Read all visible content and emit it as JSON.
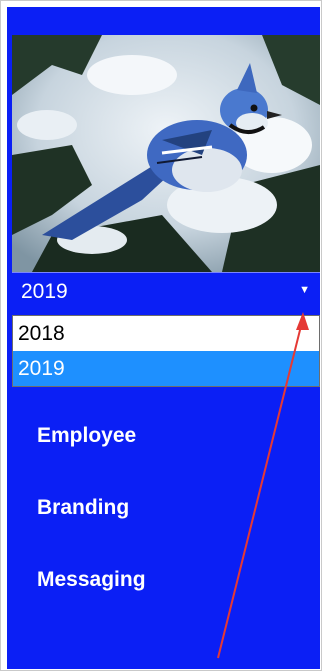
{
  "year_select": {
    "value": "2019",
    "options": [
      {
        "label": "2018",
        "selected": false
      },
      {
        "label": "2019",
        "selected": true
      }
    ]
  },
  "nav": {
    "items": [
      {
        "label": "Employee"
      },
      {
        "label": "Branding"
      },
      {
        "label": "Messaging"
      }
    ]
  },
  "colors": {
    "sidebar_bg": "#0b1ff5",
    "selected_option_bg": "#1e90ff",
    "annotation_arrow": "#e53935"
  },
  "icons": {
    "dropdown": "caret-down-icon",
    "annotation": "red-arrow-annotation"
  }
}
